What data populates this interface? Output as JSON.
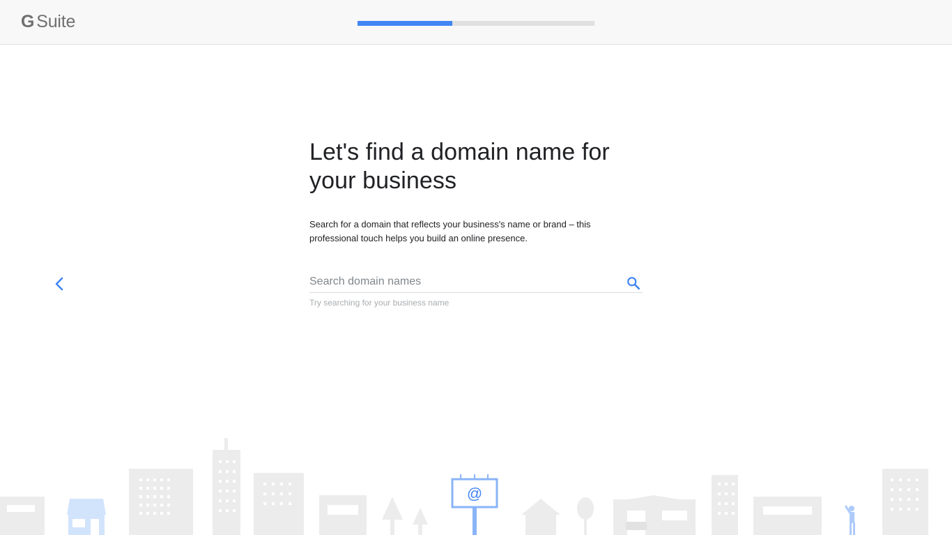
{
  "header": {
    "logo_g": "G",
    "logo_suite": "Suite",
    "progress_fraction": 0.4
  },
  "main": {
    "title_line1": "Let's find a domain name for",
    "title_line2": "your business",
    "description": "Search for a domain that reflects your business's name or brand – this professional touch helps you build an online presence."
  },
  "search": {
    "placeholder": "Search domain names",
    "value": "",
    "hint": "Try searching for your business name"
  },
  "illustration": {
    "billboard_text": "@"
  },
  "colors": {
    "accent": "#4285f4",
    "progress_track": "#e0e0e0",
    "skyline_gray": "#ececec",
    "skyline_blue": "#d2e3fc"
  },
  "icons": {
    "back": "chevron-left-icon",
    "search": "search-icon"
  }
}
